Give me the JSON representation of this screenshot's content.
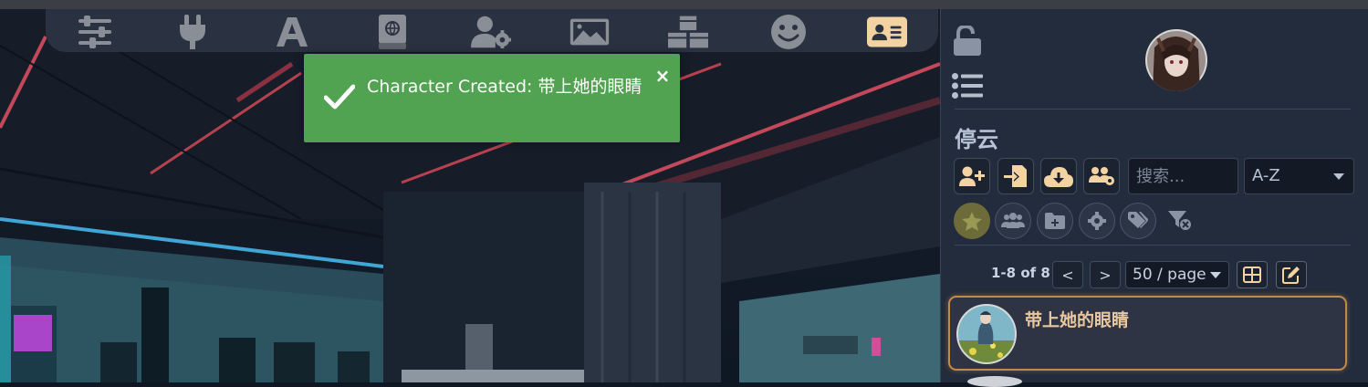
{
  "top_nav": {
    "icons": [
      {
        "name": "sliders-icon",
        "active": false
      },
      {
        "name": "plug-icon",
        "active": false
      },
      {
        "name": "font-icon",
        "active": false
      },
      {
        "name": "book-atlas-icon",
        "active": false
      },
      {
        "name": "user-gear-icon",
        "active": false
      },
      {
        "name": "image-icon",
        "active": false
      },
      {
        "name": "cubes-icon",
        "active": false
      },
      {
        "name": "smile-icon",
        "active": false
      },
      {
        "name": "address-card-icon",
        "active": true
      }
    ],
    "icon_color": "#8a8f97",
    "active_color": "#f4d3a2"
  },
  "toast": {
    "message": "Character Created: 带上她的眼睛",
    "close": "×",
    "color": "#51a351"
  },
  "panel": {
    "group_title": "停云",
    "search_placeholder": "搜索...",
    "sort_value": "A-Z",
    "pagination": {
      "count": "1-8 of 8",
      "prev": "<",
      "next": ">",
      "page_size": "50 / page"
    },
    "characters": [
      {
        "name": "带上她的眼睛",
        "selected": true
      }
    ],
    "accent": "#c28a4a"
  }
}
